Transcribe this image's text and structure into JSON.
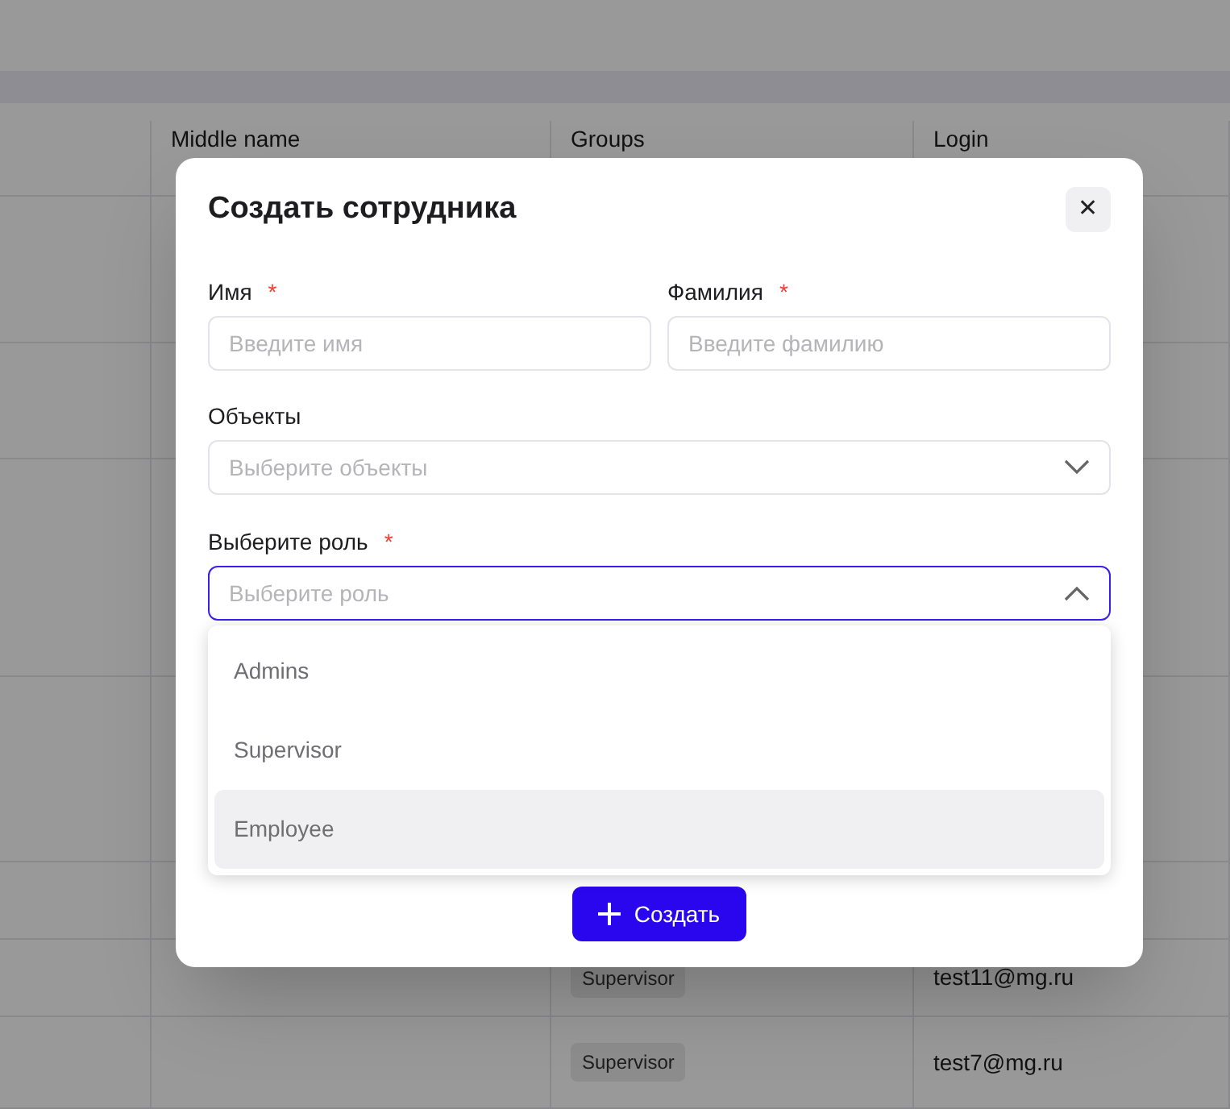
{
  "table": {
    "columns": [
      "Middle name",
      "Groups",
      "Login"
    ],
    "rows": [
      {
        "group": "Supervisor",
        "login": "test11@mg.ru"
      },
      {
        "group": "Supervisor",
        "login": "test7@mg.ru"
      }
    ]
  },
  "dialog": {
    "title": "Создать сотрудника",
    "close": "✕",
    "name_fields": [
      {
        "label": "Имя",
        "required_mark": "*",
        "placeholder": "Введите имя"
      },
      {
        "label": "Фамилия",
        "required_mark": "*",
        "placeholder": "Введите фамилию"
      }
    ],
    "objects": {
      "label": "Объекты",
      "placeholder": "Выберите объекты",
      "expanded": false
    },
    "role": {
      "label": "Выберите роль",
      "required_mark": "*",
      "placeholder": "Выберите роль",
      "expanded": true,
      "options": [
        {
          "label": "Admins",
          "selected": false
        },
        {
          "label": "Supervisor",
          "selected": false
        },
        {
          "label": "Employee",
          "selected": true
        }
      ]
    },
    "submit": {
      "label": "Создать"
    }
  }
}
